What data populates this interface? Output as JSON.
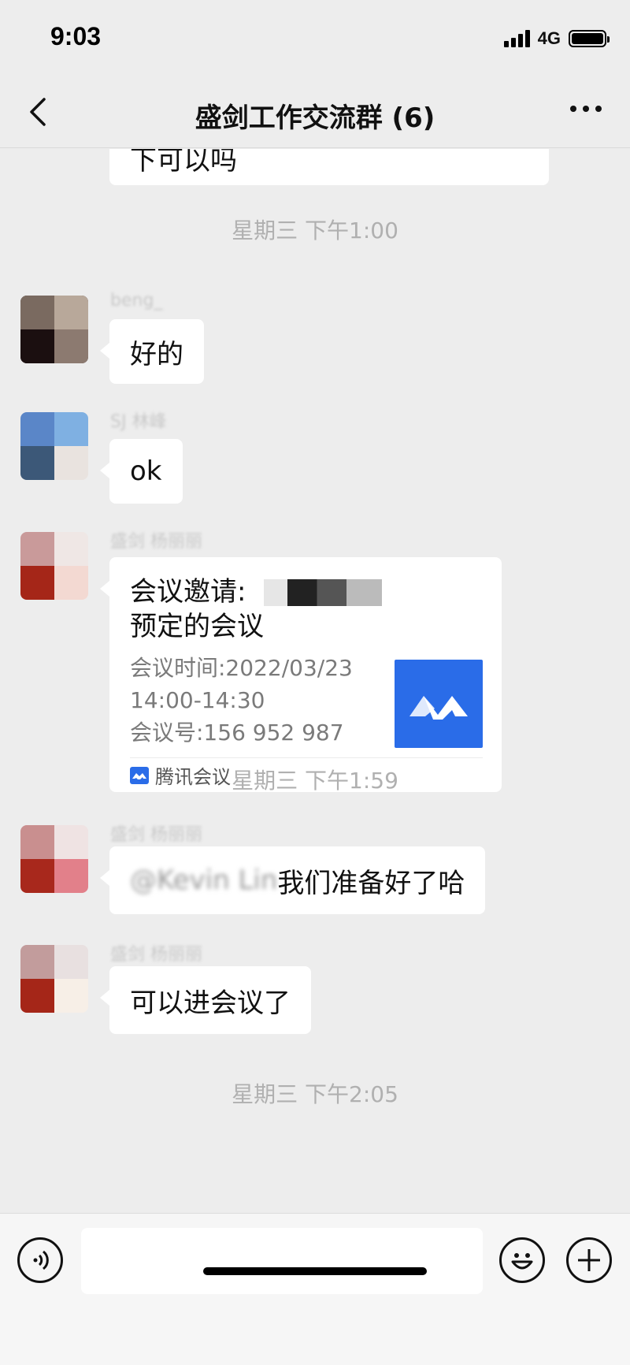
{
  "status_bar": {
    "time": "9:03",
    "network": "4G"
  },
  "nav": {
    "title": "盛剑工作交流群 (6)"
  },
  "messages": {
    "partial_text": "下可以吗",
    "time1": "星期三 下午1:00",
    "msg1": {
      "sender": "beng_",
      "text": "好的"
    },
    "msg2": {
      "sender": "SJ 林峰",
      "text": "ok"
    },
    "msg3": {
      "sender": "盛剑 杨丽丽",
      "card": {
        "title_line1": "会议邀请: ",
        "title_line2": "预定的会议",
        "time_label": "会议时间:2022/03/23",
        "time_range": "14:00-14:30",
        "meeting_id": "会议号:156 952 987",
        "app_name": "腾讯会议"
      }
    },
    "time2": "星期三 下午1:59",
    "msg4": {
      "sender": "盛剑 杨丽丽",
      "mention": "@Kevin Lin",
      "text": " 我们准备好了哈"
    },
    "msg5": {
      "sender": "盛剑 杨丽丽",
      "text": "可以进会议了"
    },
    "time3": "星期三 下午2:05"
  },
  "colors": {
    "background": "#ededed",
    "bubble": "#ffffff",
    "tencent_meeting_blue": "#2a6ce8"
  },
  "icons": [
    "back-icon",
    "more-icon",
    "voice-icon",
    "emoji-icon",
    "plus-icon"
  ]
}
